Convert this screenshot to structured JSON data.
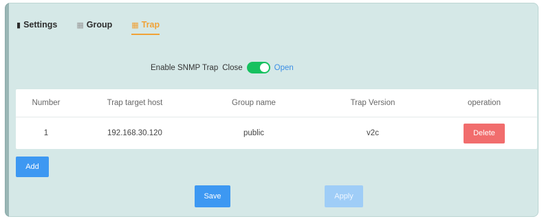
{
  "tabs": [
    {
      "label": "Settings",
      "icon": "document-icon",
      "active": false
    },
    {
      "label": "Group",
      "icon": "calendar-icon",
      "active": false
    },
    {
      "label": "Trap",
      "icon": "calendar-icon",
      "active": true
    }
  ],
  "snmp_trap": {
    "label": "Enable SNMP Trap",
    "off_label": "Close",
    "on_label": "Open",
    "enabled": true
  },
  "table": {
    "headers": [
      "Number",
      "Trap target host",
      "Group name",
      "Trap Version",
      "operation"
    ],
    "rows": [
      {
        "number": "1",
        "host": "192.168.30.120",
        "group": "public",
        "version": "v2c",
        "action": "Delete"
      }
    ]
  },
  "buttons": {
    "add": "Add",
    "save": "Save",
    "apply": "Apply"
  },
  "colors": {
    "accent": "#f0a237",
    "primary": "#3d98f2",
    "danger": "#f16d6d",
    "toggle_on": "#16c15f"
  }
}
